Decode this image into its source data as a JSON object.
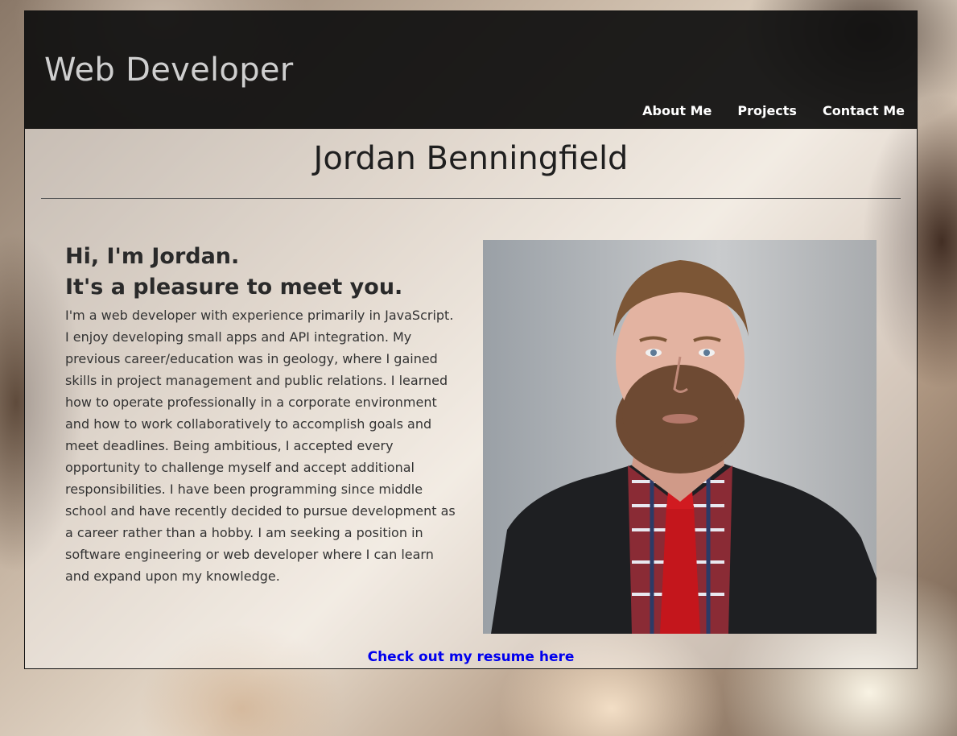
{
  "header": {
    "site_title": "Web Developer",
    "nav": [
      {
        "label": "About Me"
      },
      {
        "label": "Projects"
      },
      {
        "label": "Contact Me"
      }
    ]
  },
  "main": {
    "name": "Jordan Benningfield",
    "greeting_line1": "Hi, I'm Jordan.",
    "greeting_line2": "It's a pleasure to meet you.",
    "bio": "I'm a web developer with experience primarily in JavaScript. I enjoy developing small apps and API integration. My previous career/education was in geology, where I gained skills in project management and public relations. I learned how to operate professionally in a corporate environment and how to work collaboratively to accomplish goals and meet deadlines. Being ambitious, I accepted every opportunity to challenge myself and accept additional responsibilities. I have been programming since middle school and have recently decided to pursue development as a career rather than a hobby. I am seeking a position in software engineering or web developer where I can learn and expand upon my knowledge.",
    "resume_link": "Check out my resume here"
  },
  "colors": {
    "header_bg": "#0f0f0f",
    "link": "#0000ee",
    "title": "#cfcfcf"
  }
}
